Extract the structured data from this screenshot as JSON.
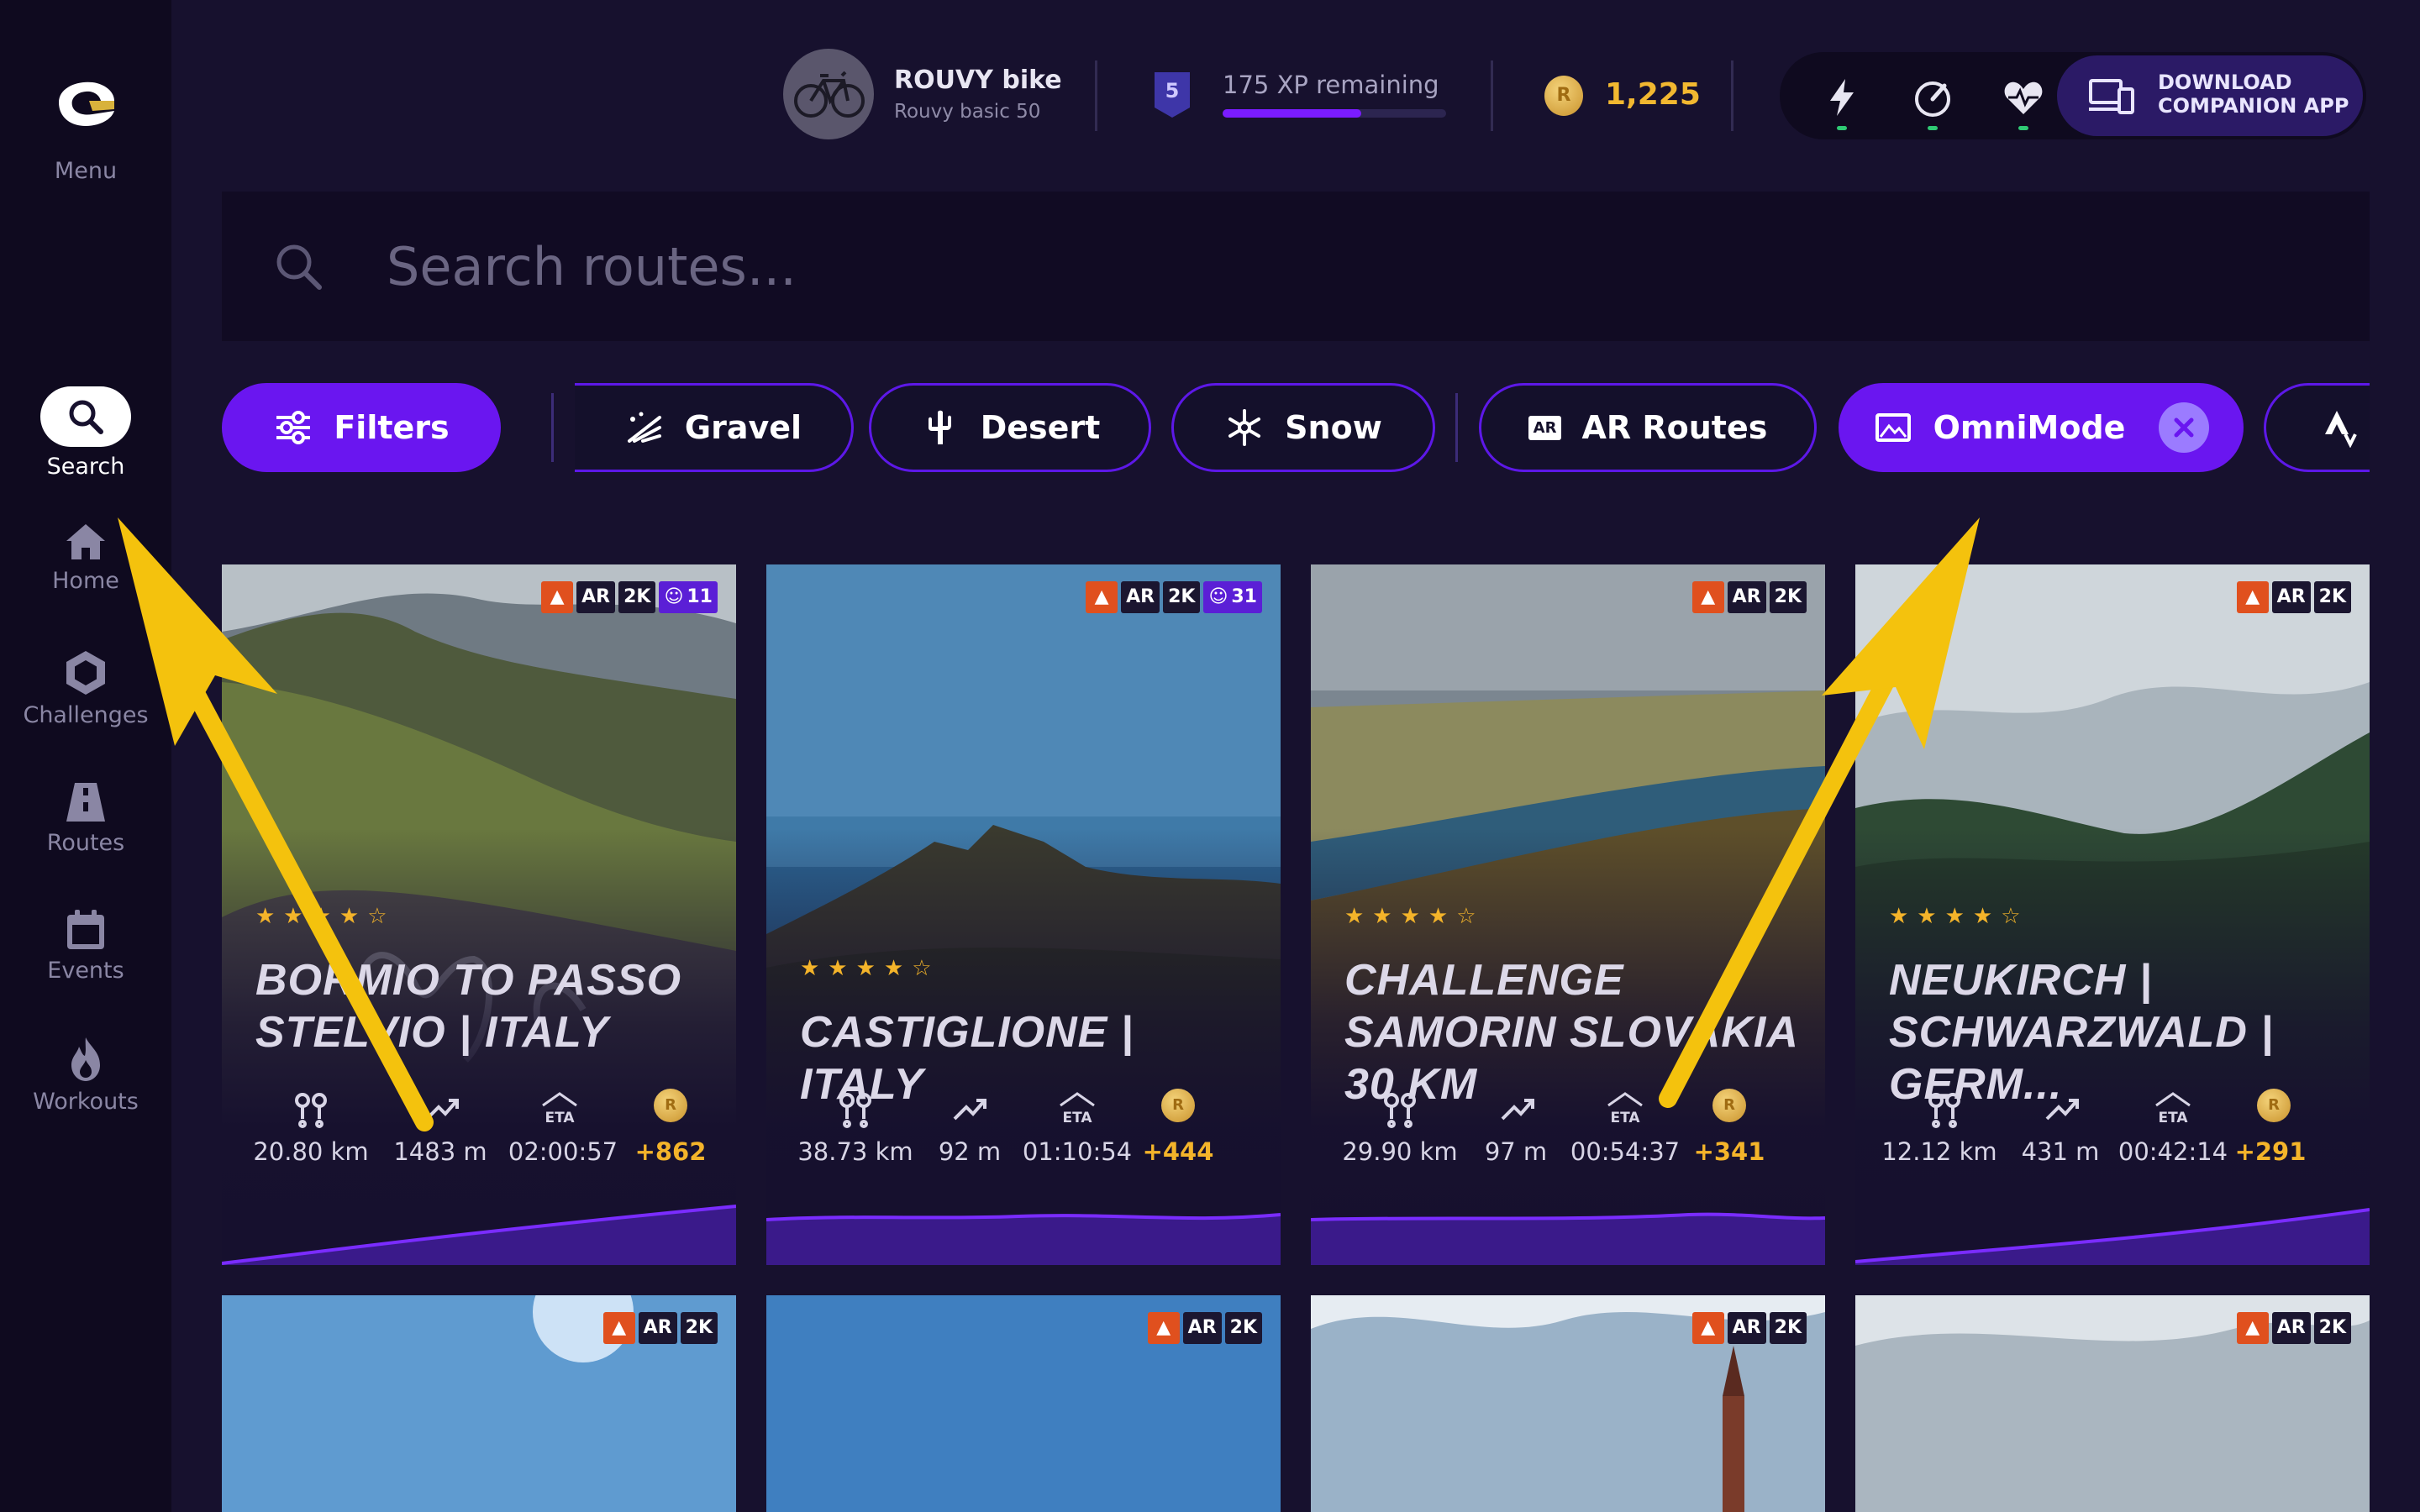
{
  "sidebar": {
    "menu_label": "Menu",
    "items": [
      {
        "label": "Search",
        "icon": "search-icon"
      },
      {
        "label": "Home",
        "icon": "home-icon"
      },
      {
        "label": "Challenges",
        "icon": "hexagon-icon"
      },
      {
        "label": "Routes",
        "icon": "road-icon"
      },
      {
        "label": "Events",
        "icon": "calendar-icon"
      },
      {
        "label": "Workouts",
        "icon": "flame-icon"
      }
    ]
  },
  "header": {
    "bike_name": "ROUVY bike",
    "bike_subtitle": "Rouvy basic 50",
    "level": "5",
    "xp_text": "175 XP remaining",
    "xp_progress": 0.62,
    "coin_symbol": "R",
    "coins": "1,225",
    "companion_line1": "DOWNLOAD",
    "companion_line2": "COMPANION APP"
  },
  "search": {
    "placeholder": "Search routes..."
  },
  "chips": {
    "filters": "Filters",
    "gravel": "Gravel",
    "desert": "Desert",
    "snow": "Snow",
    "ar_routes": "AR Routes",
    "ar_icon_text": "AR",
    "omnimode": "OmniMode"
  },
  "colors": {
    "accent": "#6a16f0",
    "gold": "#f4b42a",
    "strava": "#e0501e",
    "background": "#17112e"
  },
  "badge_labels": {
    "ar": "AR",
    "res": "2K"
  },
  "eta_label": "ETA",
  "cards": [
    {
      "title": "BORMIO TO PASSO STELVIO | ITALY",
      "rating": 4.5,
      "stars": "★★★★☆",
      "participants": "11",
      "distance": "20.80 km",
      "elevation": "1483 m",
      "eta": "02:00:57",
      "coins": "+862"
    },
    {
      "title": "CASTIGLIONE | ITALY",
      "rating": 4.5,
      "stars": "★★★★☆",
      "participants": "31",
      "distance": "38.73 km",
      "elevation": "92 m",
      "eta": "01:10:54",
      "coins": "+444"
    },
    {
      "title": "CHALLENGE SAMORIN SLOVAKIA 30 KM",
      "rating": 4,
      "stars": "★★★★☆",
      "distance": "29.90 km",
      "elevation": "97 m",
      "eta": "00:54:37",
      "coins": "+341"
    },
    {
      "title": "NEUKIRCH | SCHWARZWALD | GERM...",
      "rating": 4.5,
      "stars": "★★★★☆",
      "distance": "12.12 km",
      "elevation": "431 m",
      "eta": "00:42:14",
      "coins": "+291"
    }
  ]
}
